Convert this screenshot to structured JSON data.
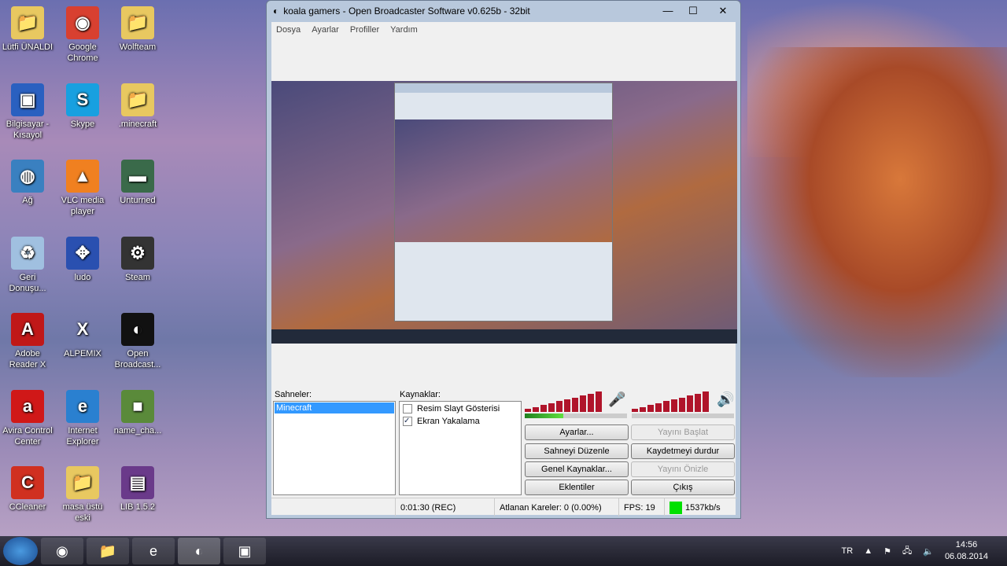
{
  "desktop_icons": [
    {
      "label": "Lütfi ÜNALDI",
      "glyph": "📁",
      "bg": "#e8c860"
    },
    {
      "label": "Google Chrome",
      "glyph": "◉",
      "bg": "#d84030"
    },
    {
      "label": "Wolfteam",
      "glyph": "📁",
      "bg": "#e8c860"
    },
    {
      "label": "Bilgisayar - Kısayol",
      "glyph": "▣",
      "bg": "#2a60c0"
    },
    {
      "label": "Skype",
      "glyph": "S",
      "bg": "#18a0e0"
    },
    {
      "label": ".minecraft",
      "glyph": "📁",
      "bg": "#e8c860"
    },
    {
      "label": "Ağ",
      "glyph": "◍",
      "bg": "#3a80c0"
    },
    {
      "label": "VLC media player",
      "glyph": "▲",
      "bg": "#f08020"
    },
    {
      "label": "Unturned",
      "glyph": "▬",
      "bg": "#3a6a4a"
    },
    {
      "label": "Geri Donuşu...",
      "glyph": "♻",
      "bg": "#a0c0e0"
    },
    {
      "label": "ludo",
      "glyph": "✥",
      "bg": "#2a50b0"
    },
    {
      "label": "Steam",
      "glyph": "⚙",
      "bg": "#333"
    },
    {
      "label": "Adobe Reader X",
      "glyph": "A",
      "bg": "#c01818"
    },
    {
      "label": "ALPEMIX",
      "glyph": "X",
      "bg": "transparent"
    },
    {
      "label": "Open Broadcast...",
      "glyph": "◐",
      "bg": "#111"
    },
    {
      "label": "Avira Control Center",
      "glyph": "a",
      "bg": "#d01818"
    },
    {
      "label": "Internet Explorer",
      "glyph": "e",
      "bg": "#2a80d0"
    },
    {
      "label": "name_cha...",
      "glyph": "■",
      "bg": "#5a8a3a"
    },
    {
      "label": "CCleaner",
      "glyph": "C",
      "bg": "#d03020"
    },
    {
      "label": "masa üstü eski",
      "glyph": "📁",
      "bg": "#e8c860"
    },
    {
      "label": "LIB 1.5.2",
      "glyph": "▤",
      "bg": "#6a3a8a"
    }
  ],
  "window": {
    "title": "koala gamers - Open Broadcaster Software v0.625b - 32bit",
    "minimize": "—",
    "maximize": "☐",
    "close": "✕"
  },
  "menu": [
    "Dosya",
    "Ayarlar",
    "Profiller",
    "Yardım"
  ],
  "scenes": {
    "label": "Sahneler:",
    "items": [
      "Minecraft"
    ]
  },
  "sources": {
    "label": "Kaynaklar:",
    "items": [
      {
        "name": "Resim Slayt Gösterisi",
        "checked": false
      },
      {
        "name": "Ekran Yakalama",
        "checked": true
      }
    ]
  },
  "mic_level": 0.38,
  "buttons": {
    "settings": "Ayarlar...",
    "start_stream": "Yayını Başlat",
    "edit_scene": "Sahneyi Düzenle",
    "stop_recording": "Kaydetmeyi durdur",
    "global_sources": "Genel Kaynaklar...",
    "preview_stream": "Yayını Önizle",
    "plugins": "Eklentiler",
    "exit": "Çıkış"
  },
  "status": {
    "time": "0:01:30 (REC)",
    "dropped": "Atlanan Kareler: 0 (0.00%)",
    "fps": "FPS: 19",
    "bitrate": "1537kb/s",
    "indicator_color": "#00e000"
  },
  "tray": {
    "lang": "TR",
    "time": "14:56",
    "date": "06.08.2014"
  }
}
